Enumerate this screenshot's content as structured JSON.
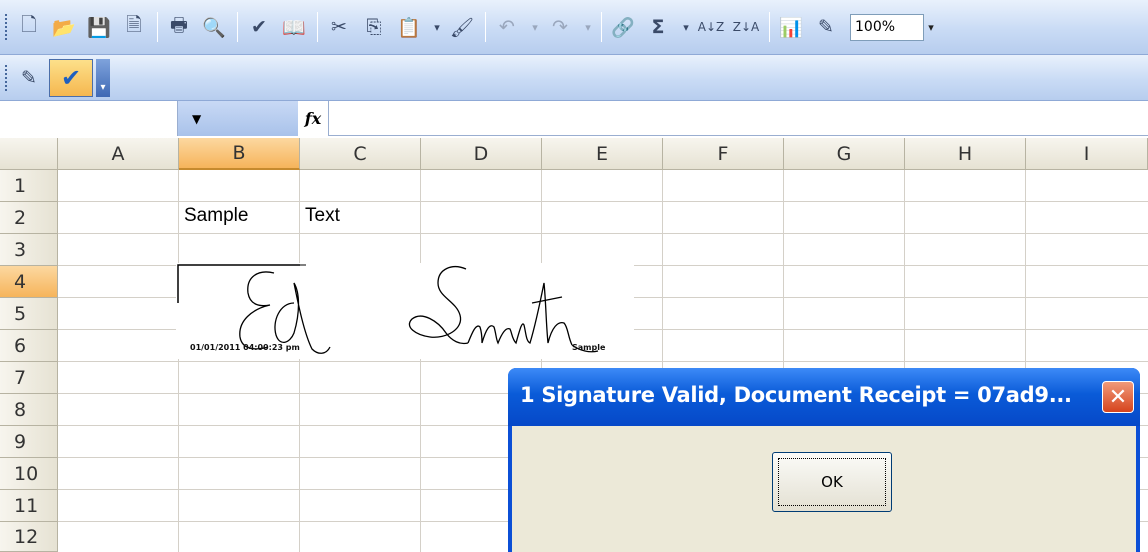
{
  "toolbar": {
    "zoom": "100%",
    "autosum": "Σ",
    "sort_ascending": "A↓Z",
    "sort_descending": "Z↓A"
  },
  "formula_bar": {
    "name_box": "",
    "fx_label": "fx",
    "formula": ""
  },
  "sheet": {
    "columns": [
      "A",
      "B",
      "C",
      "D",
      "E",
      "F",
      "G",
      "H",
      "I"
    ],
    "rows": [
      "1",
      "2",
      "3",
      "4",
      "5",
      "6",
      "7",
      "8",
      "9",
      "10",
      "11",
      "12"
    ],
    "active_column": "B",
    "active_row": "4",
    "cells": {
      "B2": "Sample",
      "C2": "Text"
    }
  },
  "signature": {
    "timestamp": "01/01/2011 04:00:23 pm",
    "tag": "Sample"
  },
  "dialog": {
    "title": "1 Signature Valid, Document Receipt = 07ad9...",
    "close_label": "✕",
    "ok_label": "OK"
  }
}
